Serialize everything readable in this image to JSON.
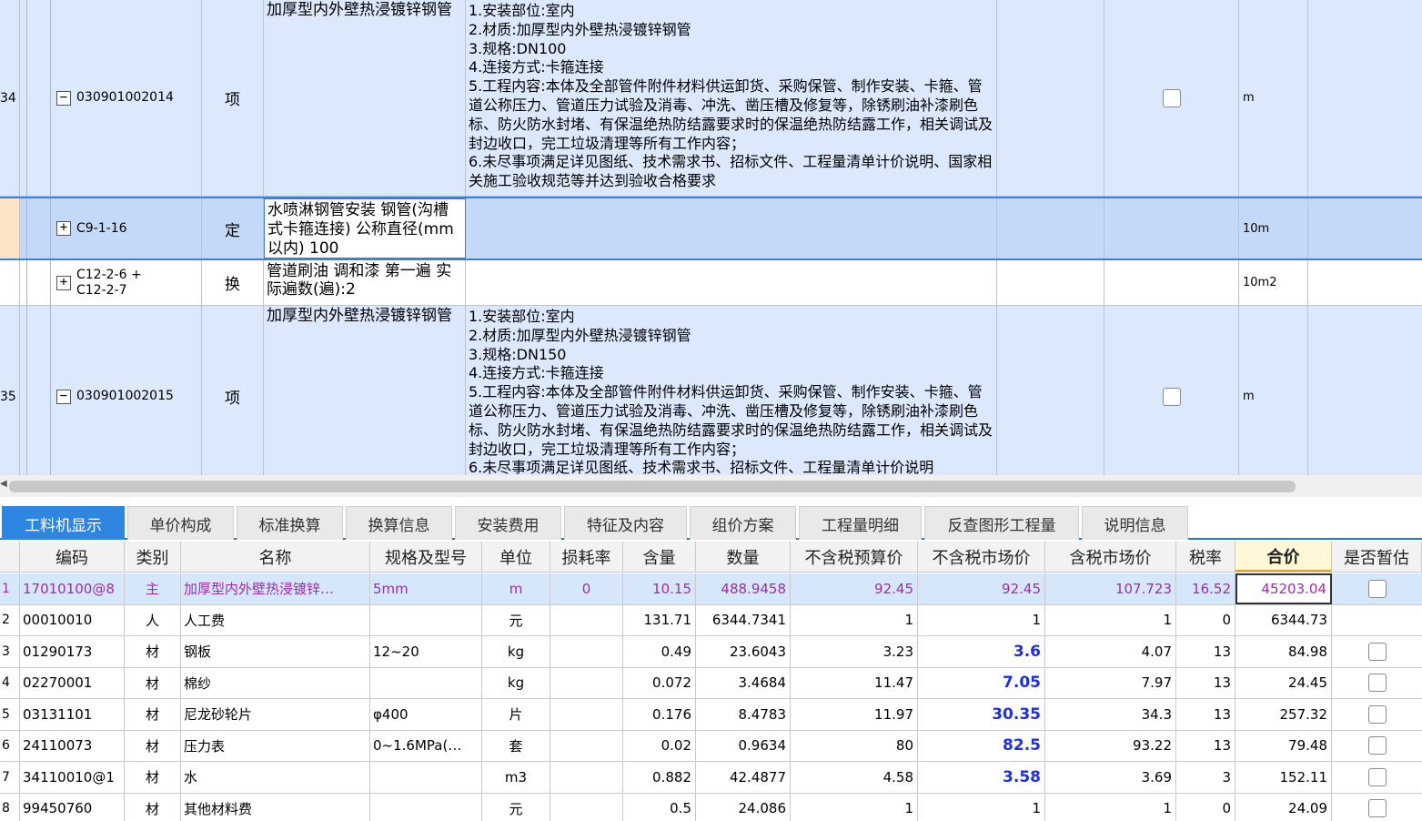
{
  "upper": {
    "rows": [
      {
        "num": "34",
        "toggle": "−",
        "code": "030901002014",
        "type": "项",
        "name": "加厚型内外壁热浸镀锌钢管",
        "desc": "1.安装部位:室内\n2.材质:加厚型内外壁热浸镀锌钢管\n3.规格:DN100\n4.连接方式:卡箍连接\n5.工程内容:本体及全部管件附件材料供运卸货、采购保管、制作安装、卡箍、管道公称压力、管道压力试验及消毒、冲洗、凿压槽及修复等，除锈刷油补漆刷色标、防火防水封堵、有保温绝热防结露要求时的保温绝热防结露工作，相关调试及封边收口，完工垃圾清理等所有工作内容；\n6.未尽事项满足详见图纸、技术需求书、招标文件、工程量清单计价说明、国家相关施工验收规范等并达到验收合格要求",
        "unit": "m",
        "has_check": true
      },
      {
        "num": "",
        "toggle": "+",
        "code": "C9-1-16",
        "type": "定",
        "name": "水喷淋钢管安装 钢管(沟槽式卡箍连接) 公称直径(mm以内) 100",
        "desc": "",
        "unit": "10m",
        "has_check": false
      },
      {
        "num": "",
        "toggle": "+",
        "code": "C12-2-6 + C12-2-7",
        "type": "换",
        "name": "管道刷油 调和漆 第一遍 实际遍数(遍):2",
        "desc": "",
        "unit": "10m2",
        "has_check": false
      },
      {
        "num": "35",
        "toggle": "−",
        "code": "030901002015",
        "type": "项",
        "name": "加厚型内外壁热浸镀锌钢管",
        "desc": "1.安装部位:室内\n2.材质:加厚型内外壁热浸镀锌钢管\n3.规格:DN150\n4.连接方式:卡箍连接\n5.工程内容:本体及全部管件附件材料供运卸货、采购保管、制作安装、卡箍、管道公称压力、管道压力试验及消毒、冲洗、凿压槽及修复等，除锈刷油补漆刷色标、防火防水封堵、有保温绝热防结露要求时的保温绝热防结露工作，相关调试及封边收口，完工垃圾清理等所有工作内容；\n6.未尽事项满足详见图纸、技术需求书、招标文件、工程量清单计价说明",
        "unit": "m",
        "has_check": true
      }
    ]
  },
  "tabs": [
    "工料机显示",
    "单价构成",
    "标准换算",
    "换算信息",
    "安装费用",
    "特征及内容",
    "组价方案",
    "工程量明细",
    "反查图形工程量",
    "说明信息"
  ],
  "lower": {
    "headers": [
      "编码",
      "类别",
      "名称",
      "规格及型号",
      "单位",
      "损耗率",
      "含量",
      "数量",
      "不含税预算价",
      "不含税市场价",
      "含税市场价",
      "税率",
      "合价",
      "是否暂估"
    ],
    "rows": [
      {
        "n": "1",
        "code": "17010100@8",
        "cat": "主",
        "name": "加厚型内外壁热浸镀锌…",
        "spec": "5mm",
        "unit": "m",
        "loss": "0",
        "content": "10.15",
        "qty": "488.9458",
        "budget": "92.45",
        "market": "92.45",
        "market_tax": "107.723",
        "tax": "16.52",
        "total": "45203.04",
        "check": true
      },
      {
        "n": "2",
        "code": "00010010",
        "cat": "人",
        "name": "人工费",
        "spec": "",
        "unit": "元",
        "loss": "",
        "content": "131.71",
        "qty": "6344.7341",
        "budget": "1",
        "market": "1",
        "market_tax": "1",
        "tax": "0",
        "total": "6344.73",
        "check": false
      },
      {
        "n": "3",
        "code": "01290173",
        "cat": "材",
        "name": "钢板",
        "spec": "12~20",
        "unit": "kg",
        "loss": "",
        "content": "0.49",
        "qty": "23.6043",
        "budget": "3.23",
        "market": "3.6",
        "market_tax": "4.07",
        "tax": "13",
        "total": "84.98",
        "check": true
      },
      {
        "n": "4",
        "code": "02270001",
        "cat": "材",
        "name": "棉纱",
        "spec": "",
        "unit": "kg",
        "loss": "",
        "content": "0.072",
        "qty": "3.4684",
        "budget": "11.47",
        "market": "7.05",
        "market_tax": "7.97",
        "tax": "13",
        "total": "24.45",
        "check": true
      },
      {
        "n": "5",
        "code": "03131101",
        "cat": "材",
        "name": "尼龙砂轮片",
        "spec": "φ400",
        "unit": "片",
        "loss": "",
        "content": "0.176",
        "qty": "8.4783",
        "budget": "11.97",
        "market": "30.35",
        "market_tax": "34.3",
        "tax": "13",
        "total": "257.32",
        "check": true
      },
      {
        "n": "6",
        "code": "24110073",
        "cat": "材",
        "name": "压力表",
        "spec": "0~1.6MPa(…",
        "unit": "套",
        "loss": "",
        "content": "0.02",
        "qty": "0.9634",
        "budget": "80",
        "market": "82.5",
        "market_tax": "93.22",
        "tax": "13",
        "total": "79.48",
        "check": true
      },
      {
        "n": "7",
        "code": "34110010@1",
        "cat": "材",
        "name": "水",
        "spec": "",
        "unit": "m3",
        "loss": "",
        "content": "0.882",
        "qty": "42.4877",
        "budget": "4.58",
        "market": "3.58",
        "market_tax": "3.69",
        "tax": "3",
        "total": "152.11",
        "check": true
      },
      {
        "n": "8",
        "code": "99450760",
        "cat": "材",
        "name": "其他材料费",
        "spec": "",
        "unit": "元",
        "loss": "",
        "content": "0.5",
        "qty": "24.086",
        "budget": "1",
        "market": "1",
        "market_tax": "1",
        "tax": "0",
        "total": "24.09",
        "check": true
      }
    ]
  },
  "colors": {
    "accent": "#2f86e0",
    "selected_row": "#c3d9f7",
    "item_row": "#dce8fc",
    "highlight_text": "#9b2fae",
    "changed_price": "#1a2ef0"
  }
}
